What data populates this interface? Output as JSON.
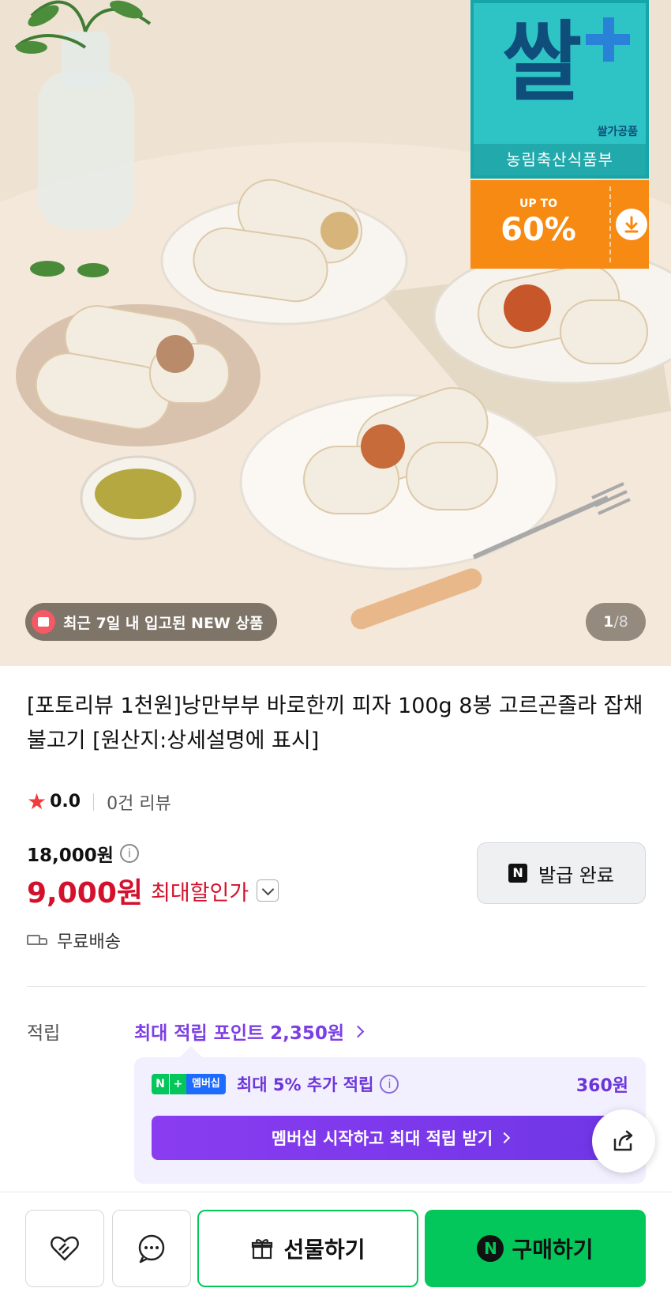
{
  "hero": {
    "rice_badge": {
      "logo_text": "쌀",
      "tag": "쌀가공품",
      "ministry": "농림축산식품부"
    },
    "sale_badge": {
      "upto": "UP TO",
      "percent": "60%",
      "icon": "download-icon"
    },
    "new_pill": "최근 7일 내 입고된 NEW 상품",
    "pager": {
      "current": "1",
      "separator": "/",
      "total": "8"
    }
  },
  "product": {
    "title": "[포토리뷰 1천원]낭만부부 바로한끼 피자 100g 8봉 고르곤졸라 잡채 불고기 [원산지:상세설명에 표시]",
    "rating": {
      "score": "0.0",
      "reviews": "0건 리뷰"
    },
    "original_price": "18,000원",
    "sale_price": "9,000원",
    "sale_label": "최대할인가",
    "coupon_button": "발급 완료",
    "coupon_logo": "N",
    "shipping": "무료배송"
  },
  "points": {
    "label": "적립",
    "link": "최대 적립 포인트 2,350원",
    "member": {
      "badge_n": "N",
      "badge_plus": "+",
      "badge_member": "멤버십",
      "text": "최대 5% 추가 적립",
      "amount": "360원",
      "button": "멤버십 시작하고 최대 적립 받기"
    }
  },
  "bottom_bar": {
    "gift": "선물하기",
    "buy": "구매하기",
    "buy_logo": "N"
  },
  "colors": {
    "sale_red": "#d4112c",
    "membership_purple": "#7b3fe4",
    "naver_green": "#03c75a",
    "badge_orange": "#f68a12",
    "badge_teal": "#2ec4c6"
  }
}
